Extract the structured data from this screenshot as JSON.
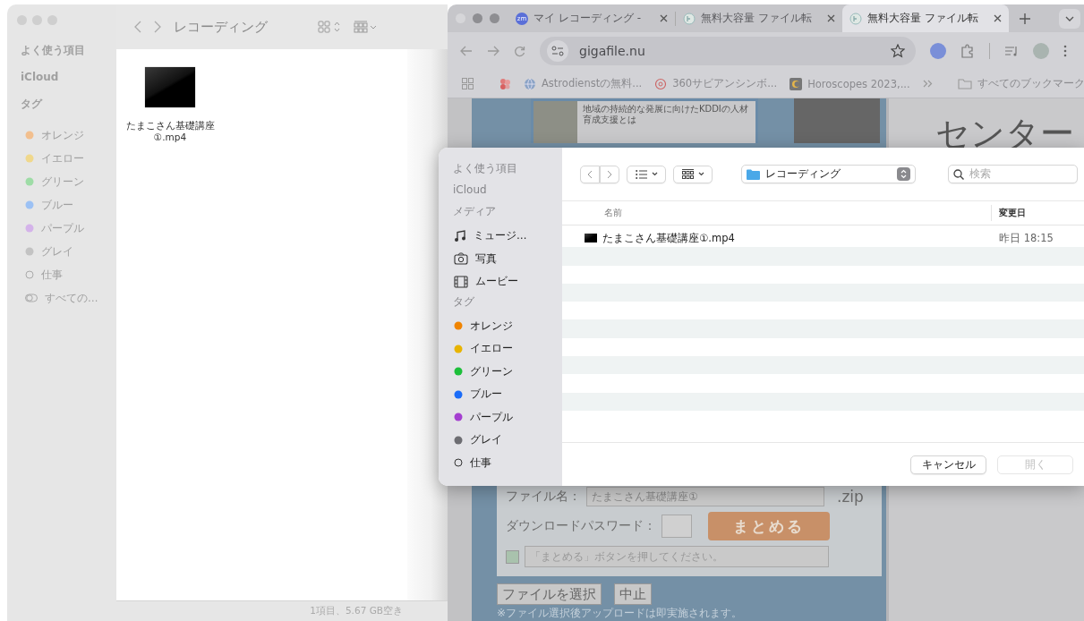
{
  "finder": {
    "title": "レコーディング",
    "sidebar": [
      {
        "kind": "header",
        "label": "よく使う項目"
      },
      {
        "kind": "header",
        "label": "iCloud"
      },
      {
        "kind": "header",
        "label": "タグ"
      },
      {
        "kind": "tag",
        "label": "オレンジ",
        "color": "#f2bf8e"
      },
      {
        "kind": "tag",
        "label": "イエロー",
        "color": "#f0d88c"
      },
      {
        "kind": "tag",
        "label": "グリーン",
        "color": "#9edca6"
      },
      {
        "kind": "tag",
        "label": "ブルー",
        "color": "#9cc1f4"
      },
      {
        "kind": "tag",
        "label": "パープル",
        "color": "#d4b3ea"
      },
      {
        "kind": "tag",
        "label": "グレイ",
        "color": "#c3c3c3"
      },
      {
        "kind": "ring",
        "label": "仕事"
      },
      {
        "kind": "all",
        "label": "すべての…"
      }
    ],
    "files": [
      {
        "name": "たまこさん基礎講座①.mp4"
      }
    ],
    "status": "1項目、5.67 GB空き"
  },
  "browser": {
    "tabs": [
      {
        "title": "マイ レコーディング -",
        "badge": "zm",
        "selected": false
      },
      {
        "title": "無料大容量 ファイル転",
        "selected": false
      },
      {
        "title": "無料大容量 ファイル転",
        "selected": true
      }
    ],
    "address": "gigafile.nu",
    "bookmarks": [
      {
        "kind": "globe",
        "label": "Astrodienstの無料..."
      },
      {
        "kind": "ring",
        "label": "360サビアンシンボ..."
      },
      {
        "kind": "square",
        "label": "Horoscopes 2023,..."
      }
    ],
    "all_bookmarks": "すべてのブックマーク",
    "page": {
      "article_caption": "地域の持続的な発展に向けたKDDIの人材育成支援とは",
      "headline": "センター",
      "filename_label": "ファイル名：",
      "filename_value": "たまこさん基礎講座①",
      "extension": ".zip",
      "password_label": "ダウンロードパスワード：",
      "submit": "まとめる",
      "message": "「まとめる」ボタンを押してください。",
      "choose": "ファイルを選択",
      "stop": "中止",
      "note": "※ファイル選択後アップロードは即実施されます。"
    }
  },
  "dialog": {
    "sidebar": [
      {
        "kind": "header",
        "label": "よく使う項目"
      },
      {
        "kind": "header",
        "label": "iCloud"
      },
      {
        "kind": "header",
        "label": "メディア"
      },
      {
        "kind": "music",
        "label": "ミュージ…"
      },
      {
        "kind": "photo",
        "label": "写真"
      },
      {
        "kind": "movie",
        "label": "ムービー"
      },
      {
        "kind": "header",
        "label": "タグ"
      },
      {
        "kind": "tag",
        "label": "オレンジ",
        "color": "#f08400"
      },
      {
        "kind": "tag",
        "label": "イエロー",
        "color": "#e8b400"
      },
      {
        "kind": "tag",
        "label": "グリーン",
        "color": "#1dbf3a"
      },
      {
        "kind": "tag",
        "label": "ブルー",
        "color": "#1b6cf8"
      },
      {
        "kind": "tag",
        "label": "パープル",
        "color": "#a43fd0"
      },
      {
        "kind": "tag",
        "label": "グレイ",
        "color": "#6d6d72"
      },
      {
        "kind": "ring",
        "label": "仕事"
      }
    ],
    "location": "レコーディング",
    "search_placeholder": "検索",
    "columns": [
      "名前",
      "変更日"
    ],
    "rows": [
      {
        "name": "たまこさん基礎講座①.mp4",
        "date": "昨日 18:15"
      }
    ],
    "buttons": [
      {
        "label": "キャンセル",
        "disabled": false
      },
      {
        "label": "開く",
        "disabled": true
      }
    ]
  }
}
